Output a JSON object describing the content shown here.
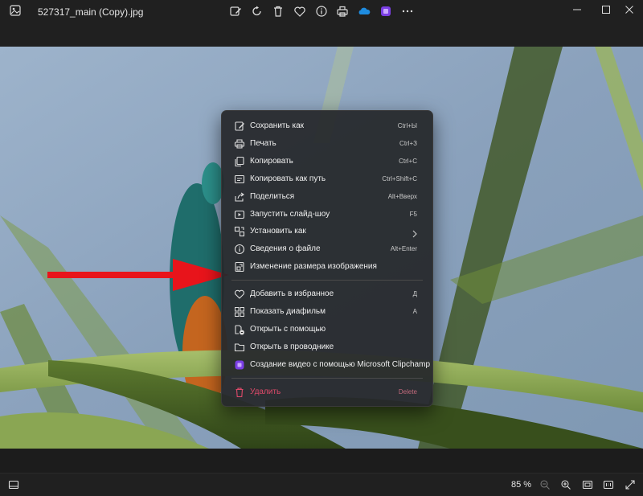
{
  "window": {
    "file_name": "527317_main (Copy).jpg",
    "toolbar_icons": [
      "edit-icon",
      "rotate-icon",
      "delete-icon",
      "favorite-icon",
      "info-icon",
      "print-icon",
      "onedrive-icon",
      "clipchamp-icon",
      "more-icon"
    ],
    "window_controls": [
      "minimize-icon",
      "maximize-icon",
      "close-icon"
    ]
  },
  "context_menu": {
    "items": [
      {
        "label": "Сохранить как",
        "shortcut": "Ctrl+Ы",
        "icon": "save-as-icon"
      },
      {
        "label": "Печать",
        "shortcut": "Ctrl+З",
        "icon": "print-icon"
      },
      {
        "label": "Копировать",
        "shortcut": "Ctrl+C",
        "icon": "copy-icon"
      },
      {
        "label": "Копировать как путь",
        "shortcut": "Ctrl+Shift+C",
        "icon": "copy-path-icon"
      },
      {
        "label": "Поделиться",
        "shortcut": "Alt+Вверх",
        "icon": "share-icon"
      },
      {
        "label": "Запустить слайд-шоу",
        "shortcut": "F5",
        "icon": "slideshow-icon"
      },
      {
        "label": "Установить как",
        "shortcut": "",
        "icon": "set-as-icon"
      },
      {
        "label": "Сведения о файле",
        "shortcut": "Alt+Enter",
        "icon": "info-icon"
      },
      {
        "label": "Изменение размера изображения",
        "shortcut": "",
        "icon": "resize-icon"
      },
      {
        "label": "Добавить в избранное",
        "shortcut": "Д",
        "icon": "heart-icon"
      },
      {
        "label": "Показать диафильм",
        "shortcut": "А",
        "icon": "filmstrip-icon"
      },
      {
        "label": "Открыть с помощью",
        "shortcut": "",
        "icon": "open-with-icon"
      },
      {
        "label": "Открыть в проводнике",
        "shortcut": "",
        "icon": "folder-icon"
      },
      {
        "label": "Создание видео с помощью Microsoft Clipchamp",
        "shortcut": "",
        "icon": "clipchamp-icon"
      },
      {
        "label": "Удалить",
        "shortcut": "Delete",
        "icon": "trash-icon"
      }
    ]
  },
  "bottom_bar": {
    "zoom": "85 %"
  },
  "colors": {
    "accent_red": "#e8141b",
    "delete_red": "#e04a6a"
  }
}
